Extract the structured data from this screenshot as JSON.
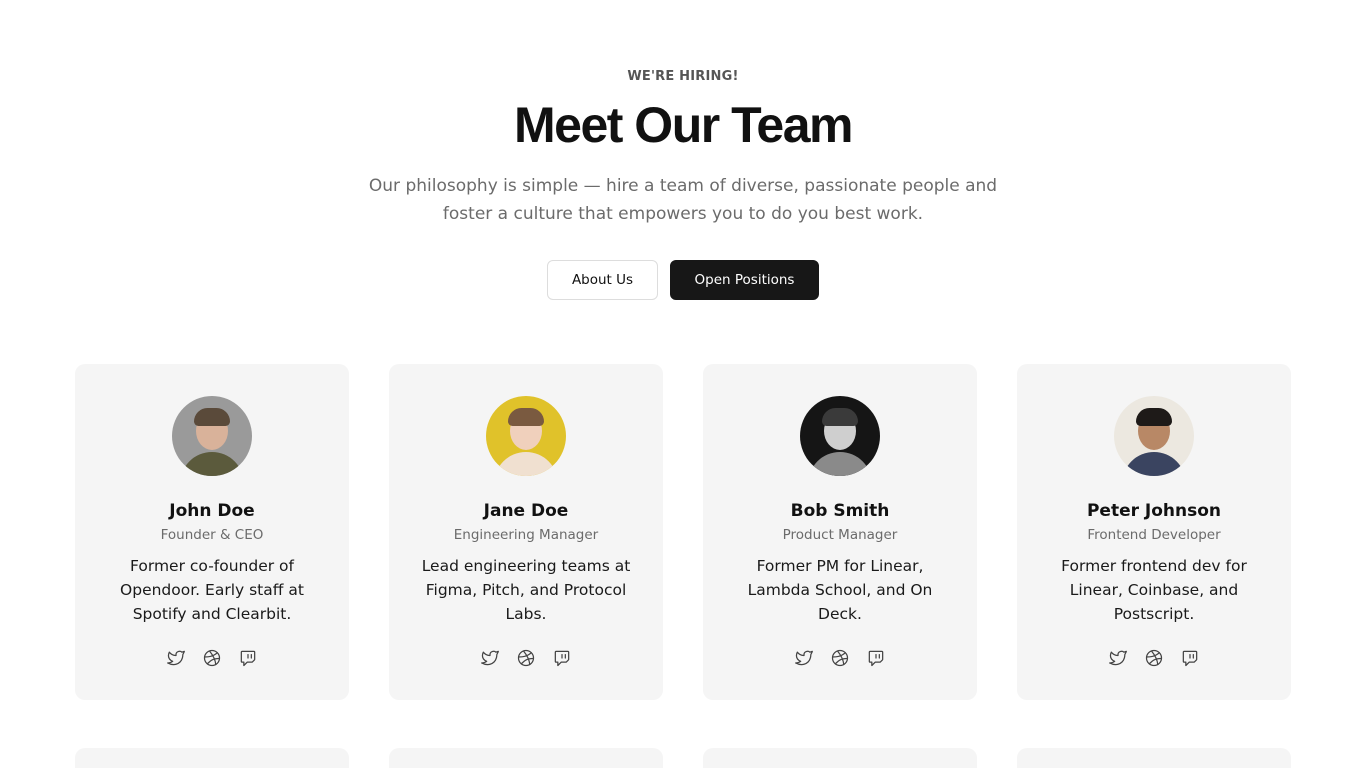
{
  "header": {
    "eyebrow": "WE'RE HIRING!",
    "title": "Meet Our Team",
    "subtitle": "Our philosophy is simple — hire a team of diverse, passionate people and foster a culture that empowers you to do you best work."
  },
  "actions": {
    "about_label": "About Us",
    "positions_label": "Open Positions"
  },
  "team": [
    {
      "name": "John Doe",
      "role": "Founder & CEO",
      "bio": "Former co-founder of Opendoor. Early staff at Spotify and Clearbit.",
      "avatar_bg": "#9a9a9a",
      "skin": "#d9b29a",
      "hair": "#5a4a3a",
      "shirt": "#5b5a3c"
    },
    {
      "name": "Jane Doe",
      "role": "Engineering Manager",
      "bio": "Lead engineering teams at Figma, Pitch, and Protocol Labs.",
      "avatar_bg": "#e0c22a",
      "skin": "#f0d0bc",
      "hair": "#7a5a40",
      "shirt": "#f0e0d0"
    },
    {
      "name": "Bob Smith",
      "role": "Product Manager",
      "bio": "Former PM for Linear, Lambda School, and On Deck.",
      "avatar_bg": "#151515",
      "skin": "#cfcfcf",
      "hair": "#3a3a3a",
      "shirt": "#8a8a8a"
    },
    {
      "name": "Peter Johnson",
      "role": "Frontend Developer",
      "bio": "Former frontend dev for Linear, Coinbase, and Postscript.",
      "avatar_bg": "#ece8e0",
      "skin": "#b88866",
      "hair": "#1e1a18",
      "shirt": "#3a4460"
    }
  ],
  "social_icons": [
    "twitter-icon",
    "dribbble-icon",
    "twitch-icon"
  ]
}
